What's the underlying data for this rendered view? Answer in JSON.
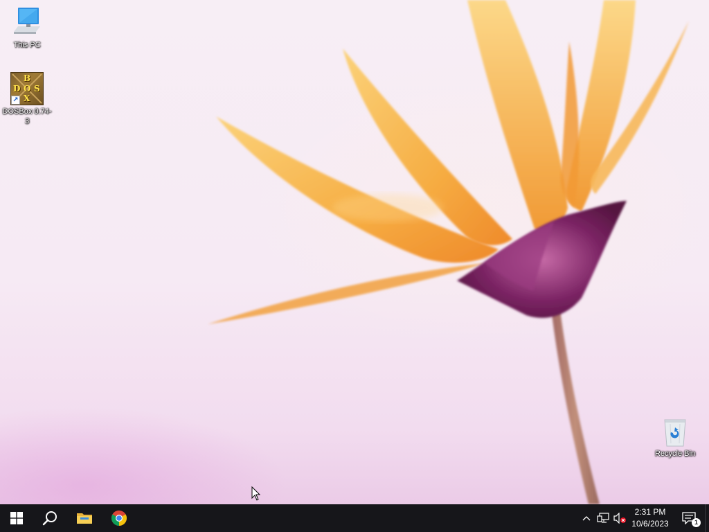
{
  "desktop": {
    "icons": [
      {
        "label": "This PC",
        "icon": "this-pc-icon"
      },
      {
        "label": "DOSBox 0.74-3",
        "icon": "dosbox-icon",
        "shortcut": true,
        "letters": [
          "B",
          "D",
          "O",
          "S",
          "X"
        ]
      },
      {
        "label": "Recycle Bin",
        "icon": "recycle-bin-icon"
      }
    ]
  },
  "taskbar": {
    "pinned": [
      {
        "name": "Start",
        "icon": "windows-logo-icon"
      },
      {
        "name": "Search",
        "icon": "search-icon"
      },
      {
        "name": "File Explorer",
        "icon": "folder-icon"
      },
      {
        "name": "Google Chrome",
        "icon": "chrome-icon"
      }
    ],
    "tray": {
      "icons": [
        "chevron-up-icon",
        "network-icon",
        "volume-muted-icon"
      ],
      "time": "2:31 PM",
      "date": "10/6/2023",
      "notification_count": "1"
    }
  },
  "colors": {
    "taskbar_bg": "#16161a",
    "wallpaper_bg": "#f6eaf4",
    "petal_orange": "#f7b44a",
    "flower_purple": "#8a2f6e"
  }
}
